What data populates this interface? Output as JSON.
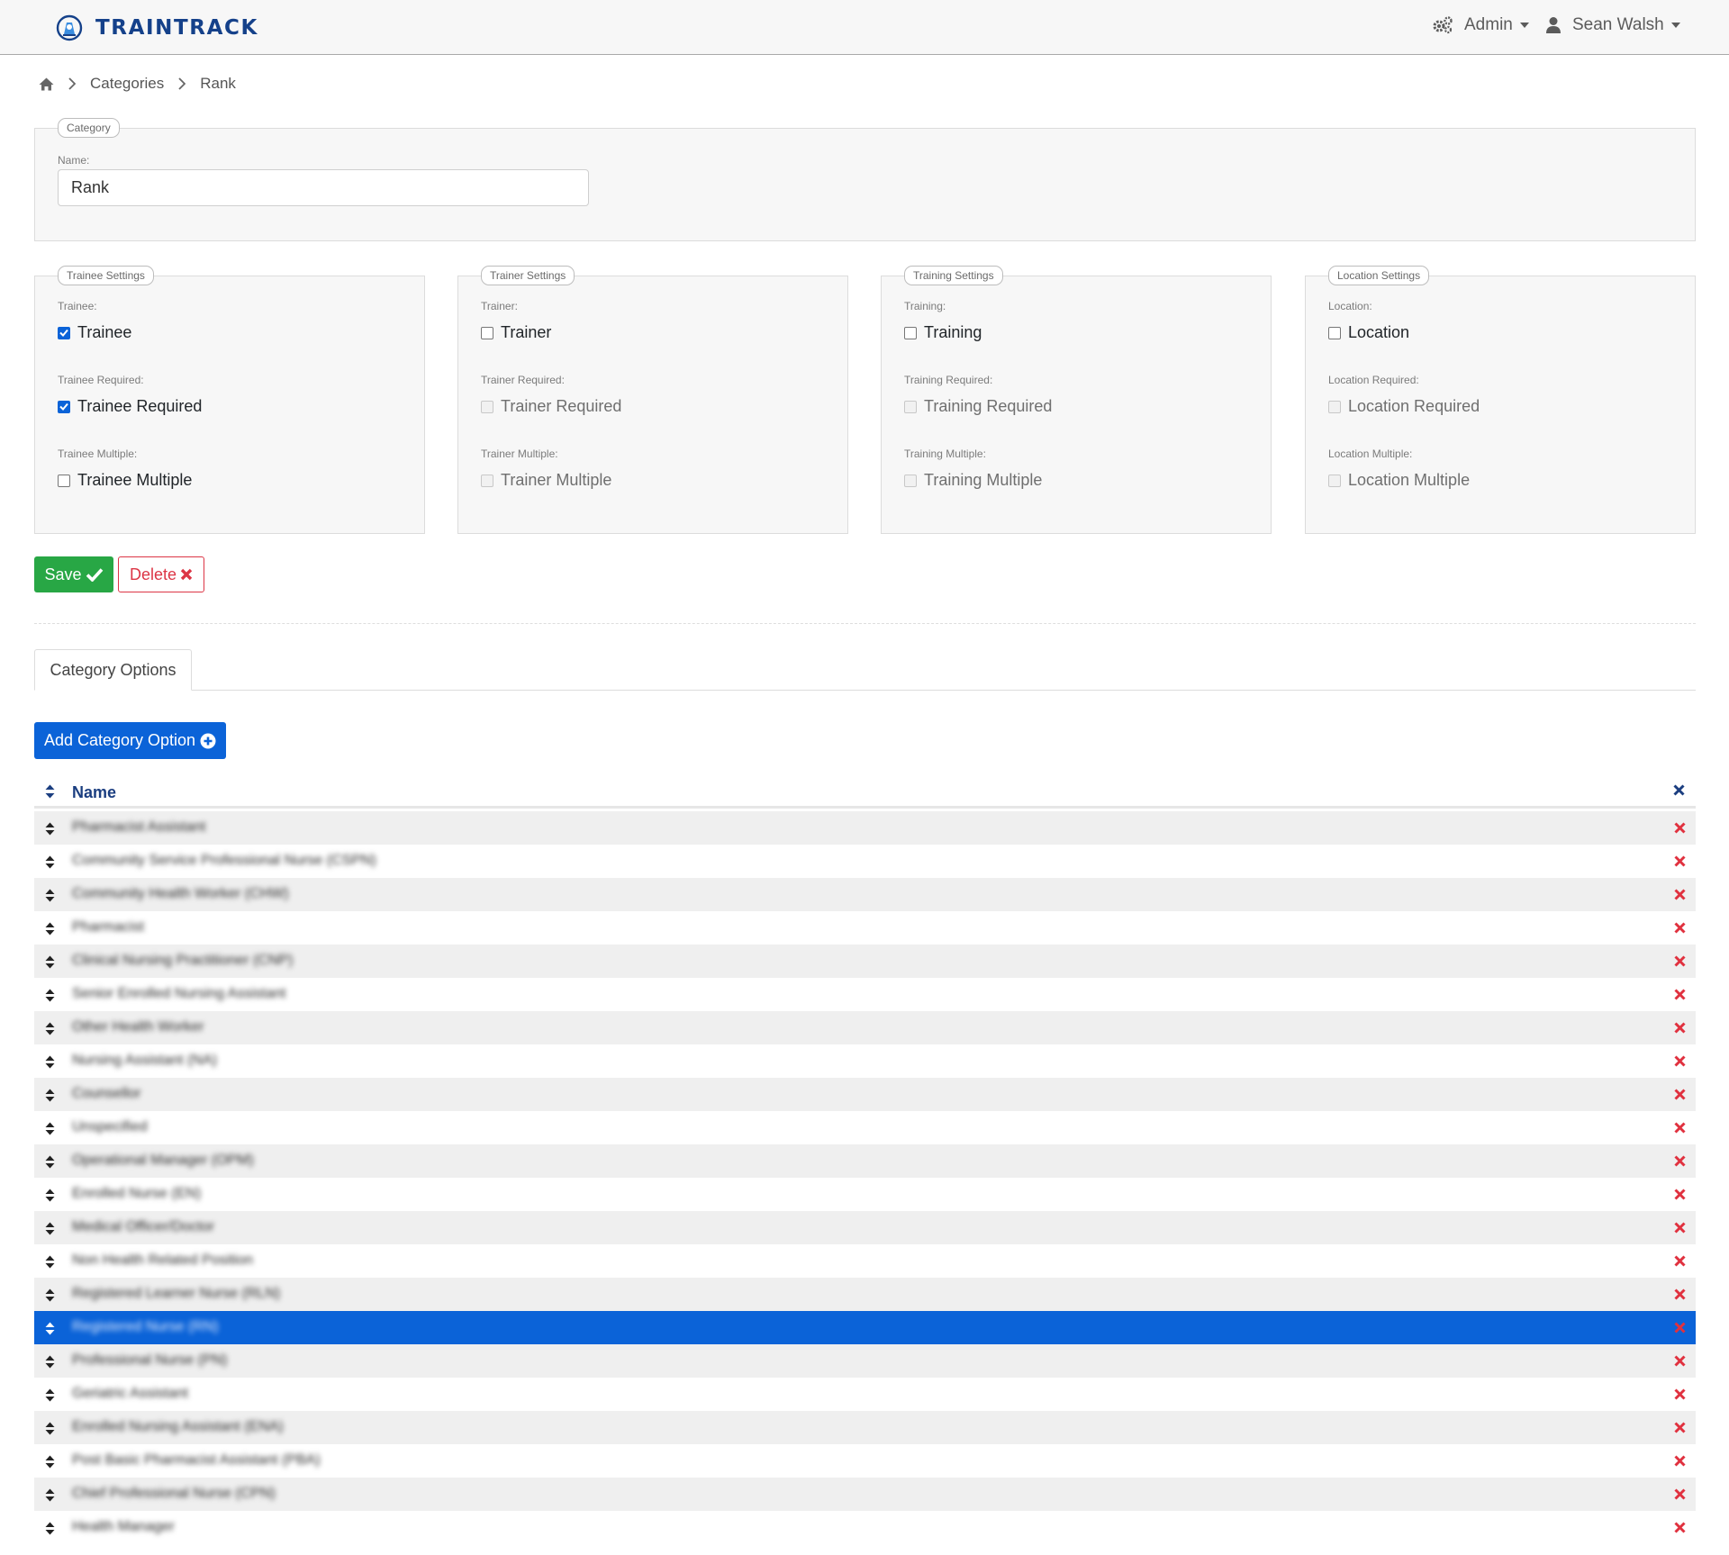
{
  "brand": {
    "name": "TRAINTRACK"
  },
  "nav": {
    "admin_label": "Admin",
    "user_label": "Sean Walsh"
  },
  "breadcrumb": {
    "items": [
      "Categories",
      "Rank"
    ]
  },
  "category": {
    "legend": "Category",
    "name_label": "Name:",
    "name_value": "Rank"
  },
  "settings": [
    {
      "legend": "Trainee Settings",
      "fields": [
        {
          "label": "Trainee:",
          "text": "Trainee",
          "checked": true,
          "disabled": false
        },
        {
          "label": "Trainee Required:",
          "text": "Trainee Required",
          "checked": true,
          "disabled": false
        },
        {
          "label": "Trainee Multiple:",
          "text": "Trainee Multiple",
          "checked": false,
          "disabled": false
        }
      ]
    },
    {
      "legend": "Trainer Settings",
      "fields": [
        {
          "label": "Trainer:",
          "text": "Trainer",
          "checked": false,
          "disabled": false
        },
        {
          "label": "Trainer Required:",
          "text": "Trainer Required",
          "checked": false,
          "disabled": true
        },
        {
          "label": "Trainer Multiple:",
          "text": "Trainer Multiple",
          "checked": false,
          "disabled": true
        }
      ]
    },
    {
      "legend": "Training Settings",
      "fields": [
        {
          "label": "Training:",
          "text": "Training",
          "checked": false,
          "disabled": false
        },
        {
          "label": "Training Required:",
          "text": "Training Required",
          "checked": false,
          "disabled": true
        },
        {
          "label": "Training Multiple:",
          "text": "Training Multiple",
          "checked": false,
          "disabled": true
        }
      ]
    },
    {
      "legend": "Location Settings",
      "fields": [
        {
          "label": "Location:",
          "text": "Location",
          "checked": false,
          "disabled": false
        },
        {
          "label": "Location Required:",
          "text": "Location Required",
          "checked": false,
          "disabled": true
        },
        {
          "label": "Location Multiple:",
          "text": "Location Multiple",
          "checked": false,
          "disabled": true
        }
      ]
    }
  ],
  "actions": {
    "save_label": "Save",
    "delete_label": "Delete"
  },
  "tabs": [
    {
      "label": "Category Options"
    }
  ],
  "options": {
    "add_label": "Add Category Option",
    "column_name": "Name",
    "selected_index": 15,
    "rows": [
      "Pharmacist Assistant",
      "Community Service Professional Nurse (CSPN)",
      "Community Health Worker (CHW)",
      "Pharmacist",
      "Clinical Nursing Practitioner (CNP)",
      "Senior Enrolled Nursing Assistant",
      "Other Health Worker",
      "Nursing Assistant (NA)",
      "Counsellor",
      "Unspecified",
      "Operational Manager (OPM)",
      "Enrolled Nurse (EN)",
      "Medical Officer/Doctor",
      "Non Health Related Position",
      "Registered Learner Nurse (RLN)",
      "Registered Nurse (RN)",
      "Professional Nurse (PN)",
      "Geriatric Assistant",
      "Enrolled Nursing Assistant (ENA)",
      "Post Basic Pharmacist Assistant (PBA)",
      "Chief Professional Nurse (CPN)",
      "Health Manager"
    ]
  },
  "colors": {
    "brand": "#15418a",
    "primary": "#0b63d8",
    "success": "#28a745",
    "danger": "#dc3545"
  },
  "icons": [
    "cogs-icon",
    "user-icon",
    "home-icon",
    "chevron-right-icon",
    "check-icon",
    "times-icon",
    "plus-circle-icon",
    "sort-icon"
  ]
}
